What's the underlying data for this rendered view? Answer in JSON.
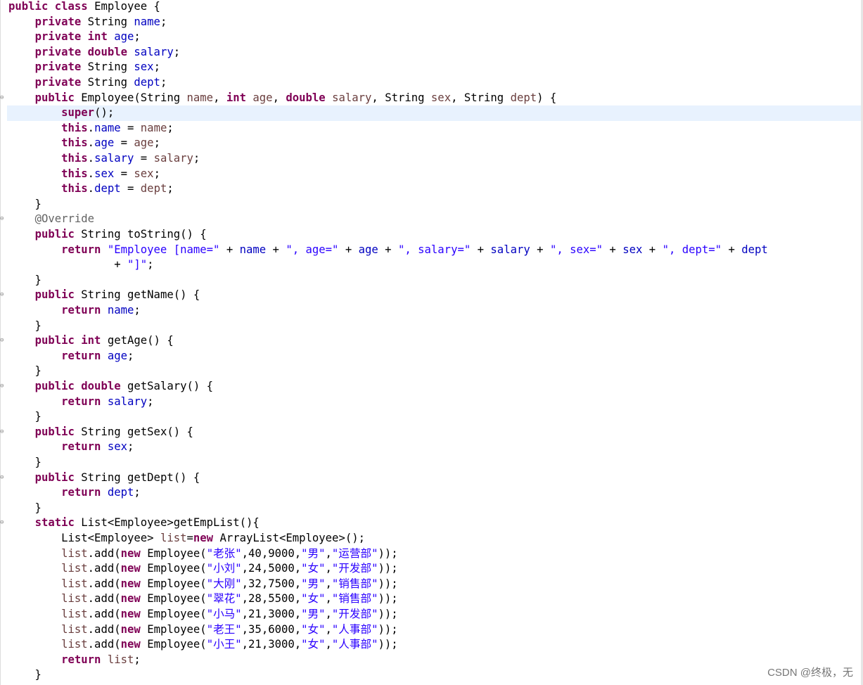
{
  "editor": {
    "lines": [
      [
        {
          "t": "public class ",
          "c": "kw"
        },
        {
          "t": "Employee {",
          "c": ""
        }
      ],
      [
        {
          "t": "    ",
          "c": ""
        },
        {
          "t": "private ",
          "c": "kw"
        },
        {
          "t": "String ",
          "c": ""
        },
        {
          "t": "name",
          "c": "fld"
        },
        {
          "t": ";",
          "c": ""
        }
      ],
      [
        {
          "t": "    ",
          "c": ""
        },
        {
          "t": "private int ",
          "c": "kw"
        },
        {
          "t": "age",
          "c": "fld"
        },
        {
          "t": ";",
          "c": ""
        }
      ],
      [
        {
          "t": "    ",
          "c": ""
        },
        {
          "t": "private double ",
          "c": "kw"
        },
        {
          "t": "salary",
          "c": "fld"
        },
        {
          "t": ";",
          "c": ""
        }
      ],
      [
        {
          "t": "    ",
          "c": ""
        },
        {
          "t": "private ",
          "c": "kw"
        },
        {
          "t": "String ",
          "c": ""
        },
        {
          "t": "sex",
          "c": "fld"
        },
        {
          "t": ";",
          "c": ""
        }
      ],
      [
        {
          "t": "    ",
          "c": ""
        },
        {
          "t": "private ",
          "c": "kw"
        },
        {
          "t": "String ",
          "c": ""
        },
        {
          "t": "dept",
          "c": "fld"
        },
        {
          "t": ";",
          "c": ""
        }
      ],
      [
        {
          "t": "    ",
          "c": ""
        },
        {
          "t": "public ",
          "c": "kw"
        },
        {
          "t": "Employee(String ",
          "c": ""
        },
        {
          "t": "name",
          "c": "prm"
        },
        {
          "t": ", ",
          "c": ""
        },
        {
          "t": "int ",
          "c": "kw"
        },
        {
          "t": "age",
          "c": "prm"
        },
        {
          "t": ", ",
          "c": ""
        },
        {
          "t": "double ",
          "c": "kw"
        },
        {
          "t": "salary",
          "c": "prm"
        },
        {
          "t": ", String ",
          "c": ""
        },
        {
          "t": "sex",
          "c": "prm"
        },
        {
          "t": ", String ",
          "c": ""
        },
        {
          "t": "dept",
          "c": "prm"
        },
        {
          "t": ") {",
          "c": ""
        }
      ],
      [
        {
          "t": "        ",
          "c": ""
        },
        {
          "t": "super",
          "c": "kw"
        },
        {
          "t": "();",
          "c": ""
        }
      ],
      [
        {
          "t": "        ",
          "c": ""
        },
        {
          "t": "this",
          "c": "kw"
        },
        {
          "t": ".",
          "c": ""
        },
        {
          "t": "name",
          "c": "fld"
        },
        {
          "t": " = ",
          "c": ""
        },
        {
          "t": "name",
          "c": "prm"
        },
        {
          "t": ";",
          "c": ""
        }
      ],
      [
        {
          "t": "        ",
          "c": ""
        },
        {
          "t": "this",
          "c": "kw"
        },
        {
          "t": ".",
          "c": ""
        },
        {
          "t": "age",
          "c": "fld"
        },
        {
          "t": " = ",
          "c": ""
        },
        {
          "t": "age",
          "c": "prm"
        },
        {
          "t": ";",
          "c": ""
        }
      ],
      [
        {
          "t": "        ",
          "c": ""
        },
        {
          "t": "this",
          "c": "kw"
        },
        {
          "t": ".",
          "c": ""
        },
        {
          "t": "salary",
          "c": "fld"
        },
        {
          "t": " = ",
          "c": ""
        },
        {
          "t": "salary",
          "c": "prm"
        },
        {
          "t": ";",
          "c": ""
        }
      ],
      [
        {
          "t": "        ",
          "c": ""
        },
        {
          "t": "this",
          "c": "kw"
        },
        {
          "t": ".",
          "c": ""
        },
        {
          "t": "sex",
          "c": "fld"
        },
        {
          "t": " = ",
          "c": ""
        },
        {
          "t": "sex",
          "c": "prm"
        },
        {
          "t": ";",
          "c": ""
        }
      ],
      [
        {
          "t": "        ",
          "c": ""
        },
        {
          "t": "this",
          "c": "kw"
        },
        {
          "t": ".",
          "c": ""
        },
        {
          "t": "dept",
          "c": "fld"
        },
        {
          "t": " = ",
          "c": ""
        },
        {
          "t": "dept",
          "c": "prm"
        },
        {
          "t": ";",
          "c": ""
        }
      ],
      [
        {
          "t": "    }",
          "c": ""
        }
      ],
      [
        {
          "t": "    ",
          "c": ""
        },
        {
          "t": "@Override",
          "c": "ann"
        }
      ],
      [
        {
          "t": "    ",
          "c": ""
        },
        {
          "t": "public ",
          "c": "kw"
        },
        {
          "t": "String toString() {",
          "c": ""
        }
      ],
      [
        {
          "t": "        ",
          "c": ""
        },
        {
          "t": "return ",
          "c": "kw"
        },
        {
          "t": "\"Employee [name=\"",
          "c": "str"
        },
        {
          "t": " + ",
          "c": ""
        },
        {
          "t": "name",
          "c": "fld"
        },
        {
          "t": " + ",
          "c": ""
        },
        {
          "t": "\", age=\"",
          "c": "str"
        },
        {
          "t": " + ",
          "c": ""
        },
        {
          "t": "age",
          "c": "fld"
        },
        {
          "t": " + ",
          "c": ""
        },
        {
          "t": "\", salary=\"",
          "c": "str"
        },
        {
          "t": " + ",
          "c": ""
        },
        {
          "t": "salary",
          "c": "fld"
        },
        {
          "t": " + ",
          "c": ""
        },
        {
          "t": "\", sex=\"",
          "c": "str"
        },
        {
          "t": " + ",
          "c": ""
        },
        {
          "t": "sex",
          "c": "fld"
        },
        {
          "t": " + ",
          "c": ""
        },
        {
          "t": "\", dept=\"",
          "c": "str"
        },
        {
          "t": " + ",
          "c": ""
        },
        {
          "t": "dept",
          "c": "fld"
        }
      ],
      [
        {
          "t": "                + ",
          "c": ""
        },
        {
          "t": "\"]\"",
          "c": "str"
        },
        {
          "t": ";",
          "c": ""
        }
      ],
      [
        {
          "t": "    }",
          "c": ""
        }
      ],
      [
        {
          "t": "    ",
          "c": ""
        },
        {
          "t": "public ",
          "c": "kw"
        },
        {
          "t": "String getName() {",
          "c": ""
        }
      ],
      [
        {
          "t": "        ",
          "c": ""
        },
        {
          "t": "return ",
          "c": "kw"
        },
        {
          "t": "name",
          "c": "fld"
        },
        {
          "t": ";",
          "c": ""
        }
      ],
      [
        {
          "t": "    }",
          "c": ""
        }
      ],
      [
        {
          "t": "    ",
          "c": ""
        },
        {
          "t": "public int ",
          "c": "kw"
        },
        {
          "t": "getAge() {",
          "c": ""
        }
      ],
      [
        {
          "t": "        ",
          "c": ""
        },
        {
          "t": "return ",
          "c": "kw"
        },
        {
          "t": "age",
          "c": "fld"
        },
        {
          "t": ";",
          "c": ""
        }
      ],
      [
        {
          "t": "    }",
          "c": ""
        }
      ],
      [
        {
          "t": "    ",
          "c": ""
        },
        {
          "t": "public double ",
          "c": "kw"
        },
        {
          "t": "getSalary() {",
          "c": ""
        }
      ],
      [
        {
          "t": "        ",
          "c": ""
        },
        {
          "t": "return ",
          "c": "kw"
        },
        {
          "t": "salary",
          "c": "fld"
        },
        {
          "t": ";",
          "c": ""
        }
      ],
      [
        {
          "t": "    }",
          "c": ""
        }
      ],
      [
        {
          "t": "    ",
          "c": ""
        },
        {
          "t": "public ",
          "c": "kw"
        },
        {
          "t": "String getSex() {",
          "c": ""
        }
      ],
      [
        {
          "t": "        ",
          "c": ""
        },
        {
          "t": "return ",
          "c": "kw"
        },
        {
          "t": "sex",
          "c": "fld"
        },
        {
          "t": ";",
          "c": ""
        }
      ],
      [
        {
          "t": "    }",
          "c": ""
        }
      ],
      [
        {
          "t": "    ",
          "c": ""
        },
        {
          "t": "public ",
          "c": "kw"
        },
        {
          "t": "String getDept() {",
          "c": ""
        }
      ],
      [
        {
          "t": "        ",
          "c": ""
        },
        {
          "t": "return ",
          "c": "kw"
        },
        {
          "t": "dept",
          "c": "fld"
        },
        {
          "t": ";",
          "c": ""
        }
      ],
      [
        {
          "t": "    }",
          "c": ""
        }
      ],
      [
        {
          "t": "    ",
          "c": ""
        },
        {
          "t": "static ",
          "c": "kw"
        },
        {
          "t": "List<Employee>getEmpList(){",
          "c": ""
        }
      ],
      [
        {
          "t": "        List<Employee> ",
          "c": ""
        },
        {
          "t": "list",
          "c": "loc"
        },
        {
          "t": "=",
          "c": ""
        },
        {
          "t": "new ",
          "c": "kw"
        },
        {
          "t": "ArrayList<Employee>();",
          "c": ""
        }
      ],
      [
        {
          "t": "        ",
          "c": ""
        },
        {
          "t": "list",
          "c": "loc"
        },
        {
          "t": ".add(",
          "c": ""
        },
        {
          "t": "new ",
          "c": "kw"
        },
        {
          "t": "Employee(",
          "c": ""
        },
        {
          "t": "\"老张\"",
          "c": "str"
        },
        {
          "t": ",40,9000,",
          "c": ""
        },
        {
          "t": "\"男\"",
          "c": "str"
        },
        {
          "t": ",",
          "c": ""
        },
        {
          "t": "\"运营部\"",
          "c": "str"
        },
        {
          "t": "));",
          "c": ""
        }
      ],
      [
        {
          "t": "        ",
          "c": ""
        },
        {
          "t": "list",
          "c": "loc"
        },
        {
          "t": ".add(",
          "c": ""
        },
        {
          "t": "new ",
          "c": "kw"
        },
        {
          "t": "Employee(",
          "c": ""
        },
        {
          "t": "\"小刘\"",
          "c": "str"
        },
        {
          "t": ",24,5000,",
          "c": ""
        },
        {
          "t": "\"女\"",
          "c": "str"
        },
        {
          "t": ",",
          "c": ""
        },
        {
          "t": "\"开发部\"",
          "c": "str"
        },
        {
          "t": "));",
          "c": ""
        }
      ],
      [
        {
          "t": "        ",
          "c": ""
        },
        {
          "t": "list",
          "c": "loc"
        },
        {
          "t": ".add(",
          "c": ""
        },
        {
          "t": "new ",
          "c": "kw"
        },
        {
          "t": "Employee(",
          "c": ""
        },
        {
          "t": "\"大刚\"",
          "c": "str"
        },
        {
          "t": ",32,7500,",
          "c": ""
        },
        {
          "t": "\"男\"",
          "c": "str"
        },
        {
          "t": ",",
          "c": ""
        },
        {
          "t": "\"销售部\"",
          "c": "str"
        },
        {
          "t": "));",
          "c": ""
        }
      ],
      [
        {
          "t": "        ",
          "c": ""
        },
        {
          "t": "list",
          "c": "loc"
        },
        {
          "t": ".add(",
          "c": ""
        },
        {
          "t": "new ",
          "c": "kw"
        },
        {
          "t": "Employee(",
          "c": ""
        },
        {
          "t": "\"翠花\"",
          "c": "str"
        },
        {
          "t": ",28,5500,",
          "c": ""
        },
        {
          "t": "\"女\"",
          "c": "str"
        },
        {
          "t": ",",
          "c": ""
        },
        {
          "t": "\"销售部\"",
          "c": "str"
        },
        {
          "t": "));",
          "c": ""
        }
      ],
      [
        {
          "t": "        ",
          "c": ""
        },
        {
          "t": "list",
          "c": "loc"
        },
        {
          "t": ".add(",
          "c": ""
        },
        {
          "t": "new ",
          "c": "kw"
        },
        {
          "t": "Employee(",
          "c": ""
        },
        {
          "t": "\"小马\"",
          "c": "str"
        },
        {
          "t": ",21,3000,",
          "c": ""
        },
        {
          "t": "\"男\"",
          "c": "str"
        },
        {
          "t": ",",
          "c": ""
        },
        {
          "t": "\"开发部\"",
          "c": "str"
        },
        {
          "t": "));",
          "c": ""
        }
      ],
      [
        {
          "t": "        ",
          "c": ""
        },
        {
          "t": "list",
          "c": "loc"
        },
        {
          "t": ".add(",
          "c": ""
        },
        {
          "t": "new ",
          "c": "kw"
        },
        {
          "t": "Employee(",
          "c": ""
        },
        {
          "t": "\"老王\"",
          "c": "str"
        },
        {
          "t": ",35,6000,",
          "c": ""
        },
        {
          "t": "\"女\"",
          "c": "str"
        },
        {
          "t": ",",
          "c": ""
        },
        {
          "t": "\"人事部\"",
          "c": "str"
        },
        {
          "t": "));",
          "c": ""
        }
      ],
      [
        {
          "t": "        ",
          "c": ""
        },
        {
          "t": "list",
          "c": "loc"
        },
        {
          "t": ".add(",
          "c": ""
        },
        {
          "t": "new ",
          "c": "kw"
        },
        {
          "t": "Employee(",
          "c": ""
        },
        {
          "t": "\"小王\"",
          "c": "str"
        },
        {
          "t": ",21,3000,",
          "c": ""
        },
        {
          "t": "\"女\"",
          "c": "str"
        },
        {
          "t": ",",
          "c": ""
        },
        {
          "t": "\"人事部\"",
          "c": "str"
        },
        {
          "t": "));",
          "c": ""
        }
      ],
      [
        {
          "t": "        ",
          "c": ""
        },
        {
          "t": "return ",
          "c": "kw"
        },
        {
          "t": "list",
          "c": "loc"
        },
        {
          "t": ";",
          "c": ""
        }
      ],
      [
        {
          "t": "    }",
          "c": ""
        }
      ]
    ],
    "highlight_line": 7,
    "fold_lines": [
      6,
      14,
      19,
      22,
      25,
      28,
      31,
      34
    ]
  },
  "watermark": "CSDN @终极，无"
}
